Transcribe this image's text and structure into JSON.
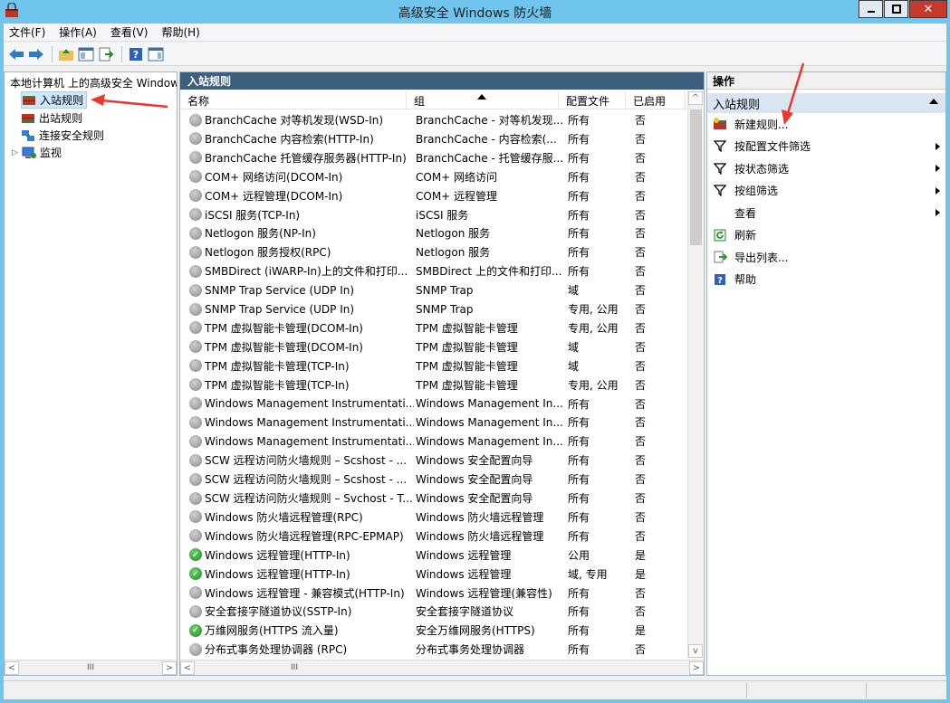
{
  "window": {
    "title": "高级安全 Windows 防火墙",
    "close_glyph": "✕"
  },
  "menu": [
    "文件(F)",
    "操作(A)",
    "查看(V)",
    "帮助(H)"
  ],
  "tree": {
    "root": "本地计算机 上的高级安全 Windows 防火墙",
    "items": [
      "入站规则",
      "出站规则",
      "连接安全规则",
      "监视"
    ],
    "selected": "入站规则"
  },
  "center": {
    "title": "入站规则",
    "columns": [
      "名称",
      "组",
      "配置文件",
      "已启用"
    ],
    "rows": [
      {
        "name": "BranchCache 对等机发现(WSD-In)",
        "group": "BranchCache - 对等机发现...",
        "profile": "所有",
        "enabled": "否",
        "on": false
      },
      {
        "name": "BranchCache 内容检索(HTTP-In)",
        "group": "BranchCache - 内容检索(...",
        "profile": "所有",
        "enabled": "否",
        "on": false
      },
      {
        "name": "BranchCache 托管缓存服务器(HTTP-In)",
        "group": "BranchCache - 托管缓存服...",
        "profile": "所有",
        "enabled": "否",
        "on": false
      },
      {
        "name": "COM+ 网络访问(DCOM-In)",
        "group": "COM+ 网络访问",
        "profile": "所有",
        "enabled": "否",
        "on": false
      },
      {
        "name": "COM+ 远程管理(DCOM-In)",
        "group": "COM+ 远程管理",
        "profile": "所有",
        "enabled": "否",
        "on": false
      },
      {
        "name": "iSCSI 服务(TCP-In)",
        "group": "iSCSI 服务",
        "profile": "所有",
        "enabled": "否",
        "on": false
      },
      {
        "name": "Netlogon 服务(NP-In)",
        "group": "Netlogon 服务",
        "profile": "所有",
        "enabled": "否",
        "on": false
      },
      {
        "name": "Netlogon 服务授权(RPC)",
        "group": "Netlogon 服务",
        "profile": "所有",
        "enabled": "否",
        "on": false
      },
      {
        "name": "SMBDirect (iWARP-In)上的文件和打印...",
        "group": "SMBDirect 上的文件和打印...",
        "profile": "所有",
        "enabled": "否",
        "on": false
      },
      {
        "name": "SNMP Trap Service (UDP In)",
        "group": "SNMP Trap",
        "profile": "域",
        "enabled": "否",
        "on": false
      },
      {
        "name": "SNMP Trap Service (UDP In)",
        "group": "SNMP Trap",
        "profile": "专用, 公用",
        "enabled": "否",
        "on": false
      },
      {
        "name": "TPM 虚拟智能卡管理(DCOM-In)",
        "group": "TPM 虚拟智能卡管理",
        "profile": "专用, 公用",
        "enabled": "否",
        "on": false
      },
      {
        "name": "TPM 虚拟智能卡管理(DCOM-In)",
        "group": "TPM 虚拟智能卡管理",
        "profile": "域",
        "enabled": "否",
        "on": false
      },
      {
        "name": "TPM 虚拟智能卡管理(TCP-In)",
        "group": "TPM 虚拟智能卡管理",
        "profile": "域",
        "enabled": "否",
        "on": false
      },
      {
        "name": "TPM 虚拟智能卡管理(TCP-In)",
        "group": "TPM 虚拟智能卡管理",
        "profile": "专用, 公用",
        "enabled": "否",
        "on": false
      },
      {
        "name": "Windows Management Instrumentati...",
        "group": "Windows Management In...",
        "profile": "所有",
        "enabled": "否",
        "on": false
      },
      {
        "name": "Windows Management Instrumentati...",
        "group": "Windows Management In...",
        "profile": "所有",
        "enabled": "否",
        "on": false
      },
      {
        "name": "Windows Management Instrumentati...",
        "group": "Windows Management In...",
        "profile": "所有",
        "enabled": "否",
        "on": false
      },
      {
        "name": "SCW 远程访问防火墙规则 – Scshost - ...",
        "group": "Windows 安全配置向导",
        "profile": "所有",
        "enabled": "否",
        "on": false
      },
      {
        "name": "SCW 远程访问防火墙规则 – Scshost - ...",
        "group": "Windows 安全配置向导",
        "profile": "所有",
        "enabled": "否",
        "on": false
      },
      {
        "name": "SCW 远程访问防火墙规则 – Svchost - T...",
        "group": "Windows 安全配置向导",
        "profile": "所有",
        "enabled": "否",
        "on": false
      },
      {
        "name": "Windows 防火墙远程管理(RPC)",
        "group": "Windows 防火墙远程管理",
        "profile": "所有",
        "enabled": "否",
        "on": false
      },
      {
        "name": "Windows 防火墙远程管理(RPC-EPMAP)",
        "group": "Windows 防火墙远程管理",
        "profile": "所有",
        "enabled": "否",
        "on": false
      },
      {
        "name": "Windows 远程管理(HTTP-In)",
        "group": "Windows 远程管理",
        "profile": "公用",
        "enabled": "是",
        "on": true
      },
      {
        "name": "Windows 远程管理(HTTP-In)",
        "group": "Windows 远程管理",
        "profile": "域, 专用",
        "enabled": "是",
        "on": true
      },
      {
        "name": "Windows 远程管理 - 兼容模式(HTTP-In)",
        "group": "Windows 远程管理(兼容性)",
        "profile": "所有",
        "enabled": "否",
        "on": false
      },
      {
        "name": "安全套接字隧道协议(SSTP-In)",
        "group": "安全套接字隧道协议",
        "profile": "所有",
        "enabled": "否",
        "on": false
      },
      {
        "name": "万维网服务(HTTPS 流入量)",
        "group": "安全万维网服务(HTTPS)",
        "profile": "所有",
        "enabled": "是",
        "on": true
      },
      {
        "name": "分布式事务处理协调器 (RPC)",
        "group": "分布式事务处理协调器",
        "profile": "所有",
        "enabled": "否",
        "on": false
      }
    ]
  },
  "actions": {
    "title": "操作",
    "section": "入站规则",
    "items": [
      {
        "label": "新建规则...",
        "icon": "new-rule-icon",
        "submenu": false
      },
      {
        "label": "按配置文件筛选",
        "icon": "filter-icon",
        "submenu": true
      },
      {
        "label": "按状态筛选",
        "icon": "filter-icon",
        "submenu": true
      },
      {
        "label": "按组筛选",
        "icon": "filter-icon",
        "submenu": true
      },
      {
        "label": "查看",
        "icon": "",
        "submenu": true
      },
      {
        "label": "刷新",
        "icon": "refresh-icon",
        "submenu": false
      },
      {
        "label": "导出列表...",
        "icon": "export-icon",
        "submenu": false
      },
      {
        "label": "帮助",
        "icon": "help-icon",
        "submenu": false
      }
    ]
  },
  "scroll": {
    "left_arrow": "<",
    "right_arrow": ">",
    "up_arrow": "^",
    "down_arrow": "v",
    "thumb": "III"
  }
}
